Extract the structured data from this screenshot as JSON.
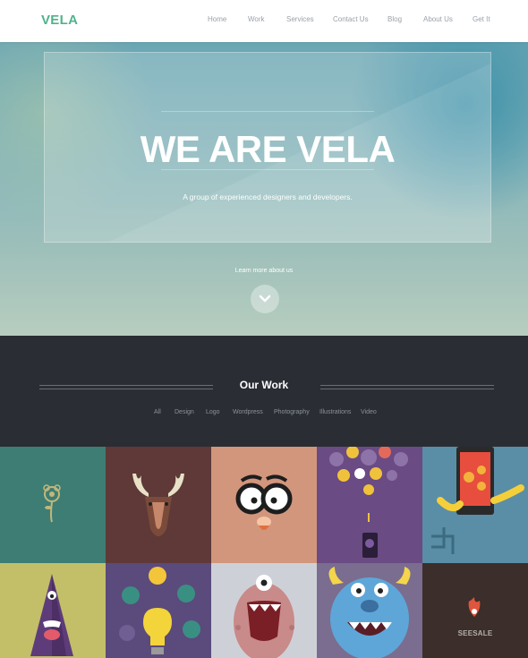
{
  "brand": {
    "logo": "VELA",
    "accent": "#4fb38c"
  },
  "nav": {
    "items": [
      {
        "label": "Home"
      },
      {
        "label": "Work"
      },
      {
        "label": "Services"
      },
      {
        "label": "Contact Us"
      },
      {
        "label": "Blog"
      },
      {
        "label": "About Us"
      },
      {
        "label": "Get It"
      }
    ]
  },
  "hero": {
    "title": "WE ARE VELA",
    "subtitle": "A group of experienced designers and developers.",
    "learn_more": "Learn more about us",
    "scroll_icon": "chevron-down-icon"
  },
  "work": {
    "title": "Our Work",
    "filters": [
      {
        "label": "All"
      },
      {
        "label": "Design"
      },
      {
        "label": "Logo"
      },
      {
        "label": "Wordpress"
      },
      {
        "label": "Photography"
      },
      {
        "label": "Illustrations"
      },
      {
        "label": "Video"
      }
    ]
  },
  "portfolio": {
    "tiles": [
      {
        "subject": "flower",
        "color": "#3d7d74"
      },
      {
        "subject": "moose",
        "color": "#5e3937"
      },
      {
        "subject": "glasses-face",
        "color": "#d2967d"
      },
      {
        "subject": "phone-apps",
        "color": "#6a4b83"
      },
      {
        "subject": "tablet-hands",
        "color": "#5a8ea6"
      },
      {
        "subject": "purple-monster",
        "color": "#c2bf68"
      },
      {
        "subject": "lightbulb-ideas",
        "color": "#5b4a7c"
      },
      {
        "subject": "pink-monster",
        "color": "#cdd1d7"
      },
      {
        "subject": "blue-monster",
        "color": "#7a6d8f"
      },
      {
        "subject": "seesale-logo",
        "color": "#3c2e2a",
        "label": "SEESALE"
      }
    ]
  }
}
